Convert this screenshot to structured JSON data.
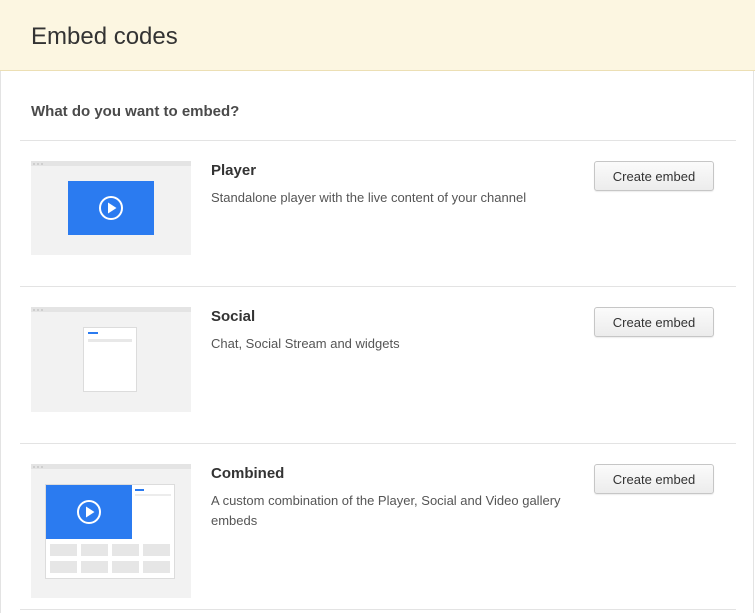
{
  "header": {
    "title": "Embed codes"
  },
  "question": "What do you want to embed?",
  "items": [
    {
      "title": "Player",
      "description": "Standalone player with the live content of your channel",
      "button_label": "Create embed",
      "preview_icon": "play-icon"
    },
    {
      "title": "Social",
      "description": "Chat, Social Stream and widgets",
      "button_label": "Create embed",
      "preview_icon": "social-widget-icon"
    },
    {
      "title": "Combined",
      "description": "A custom combination of the Player, Social and Video gallery embeds",
      "button_label": "Create embed",
      "preview_icon": "play-icon"
    }
  ],
  "colors": {
    "header_bg": "#fcf6e1",
    "player_blue": "#2b7bf0",
    "accent_line": "#2b7bf0"
  }
}
